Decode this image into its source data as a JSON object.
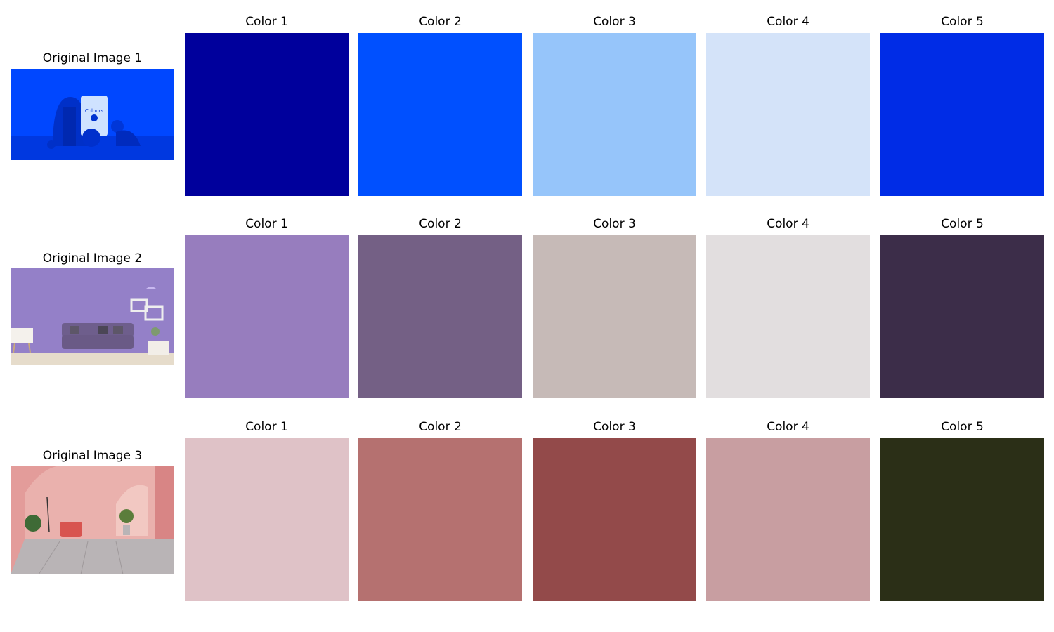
{
  "rows": [
    {
      "original_title": "Original Image 1",
      "image_caption": "Colours",
      "swatches": [
        {
          "label": "Color 1",
          "color": "#00009C"
        },
        {
          "label": "Color 2",
          "color": "#0050FF"
        },
        {
          "label": "Color 3",
          "color": "#96C5FA"
        },
        {
          "label": "Color 4",
          "color": "#D4E3F9"
        },
        {
          "label": "Color 5",
          "color": "#002CE6"
        }
      ]
    },
    {
      "original_title": "Original Image 2",
      "swatches": [
        {
          "label": "Color 1",
          "color": "#977DBE"
        },
        {
          "label": "Color 2",
          "color": "#746085"
        },
        {
          "label": "Color 3",
          "color": "#C6BAB7"
        },
        {
          "label": "Color 4",
          "color": "#E2DEDF"
        },
        {
          "label": "Color 5",
          "color": "#3C2D49"
        }
      ]
    },
    {
      "original_title": "Original Image 3",
      "swatches": [
        {
          "label": "Color 1",
          "color": "#DFC2C7"
        },
        {
          "label": "Color 2",
          "color": "#B57170"
        },
        {
          "label": "Color 3",
          "color": "#934A4A"
        },
        {
          "label": "Color 4",
          "color": "#C89EA1"
        },
        {
          "label": "Color 5",
          "color": "#2B2F17"
        }
      ]
    }
  ]
}
